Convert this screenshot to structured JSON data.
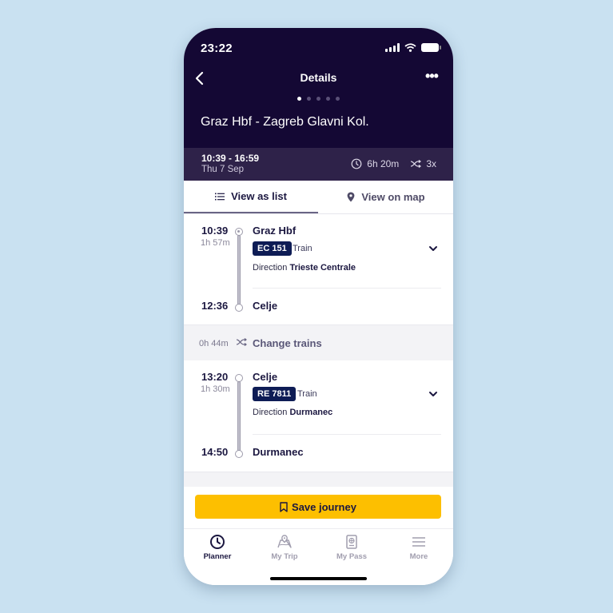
{
  "status_bar": {
    "time": "23:22"
  },
  "header": {
    "title": "Details",
    "route": "Graz Hbf - Zagreb Glavni Kol.",
    "page_dots": 5,
    "active_dot": 0
  },
  "summary": {
    "time_range": "10:39 - 16:59",
    "date": "Thu 7 Sep",
    "duration": "6h 20m",
    "changes": "3x"
  },
  "tabs": [
    {
      "label": "View as list",
      "active": true
    },
    {
      "label": "View on map",
      "active": false
    }
  ],
  "legs": [
    {
      "dep_time": "10:39",
      "duration": "1h 57m",
      "from": "Graz Hbf",
      "train": "EC 151",
      "mode": "Train",
      "direction_label": "Direction",
      "direction": "Trieste Centrale",
      "arr_time": "12:36",
      "to": "Celje"
    },
    {
      "dep_time": "13:20",
      "duration": "1h 30m",
      "from": "Celje",
      "train": "RE 7811",
      "mode": "Train",
      "direction_label": "Direction",
      "direction": "Durmanec",
      "arr_time": "14:50",
      "to": "Durmanec"
    }
  ],
  "transfer": {
    "duration": "0h 44m",
    "label": "Change trains"
  },
  "save_button": {
    "label": "Save journey"
  },
  "bottom_nav": [
    {
      "label": "Planner",
      "icon": "clock-icon",
      "active": true
    },
    {
      "label": "My Trip",
      "icon": "map-pin-icon",
      "active": false
    },
    {
      "label": "My Pass",
      "icon": "passport-icon",
      "active": false
    },
    {
      "label": "More",
      "icon": "menu-icon",
      "active": false
    }
  ],
  "colors": {
    "header_bg": "#140834",
    "summary_bg": "#2e2249",
    "accent_yellow": "#fdbf00",
    "badge_navy": "#0e1c55"
  }
}
